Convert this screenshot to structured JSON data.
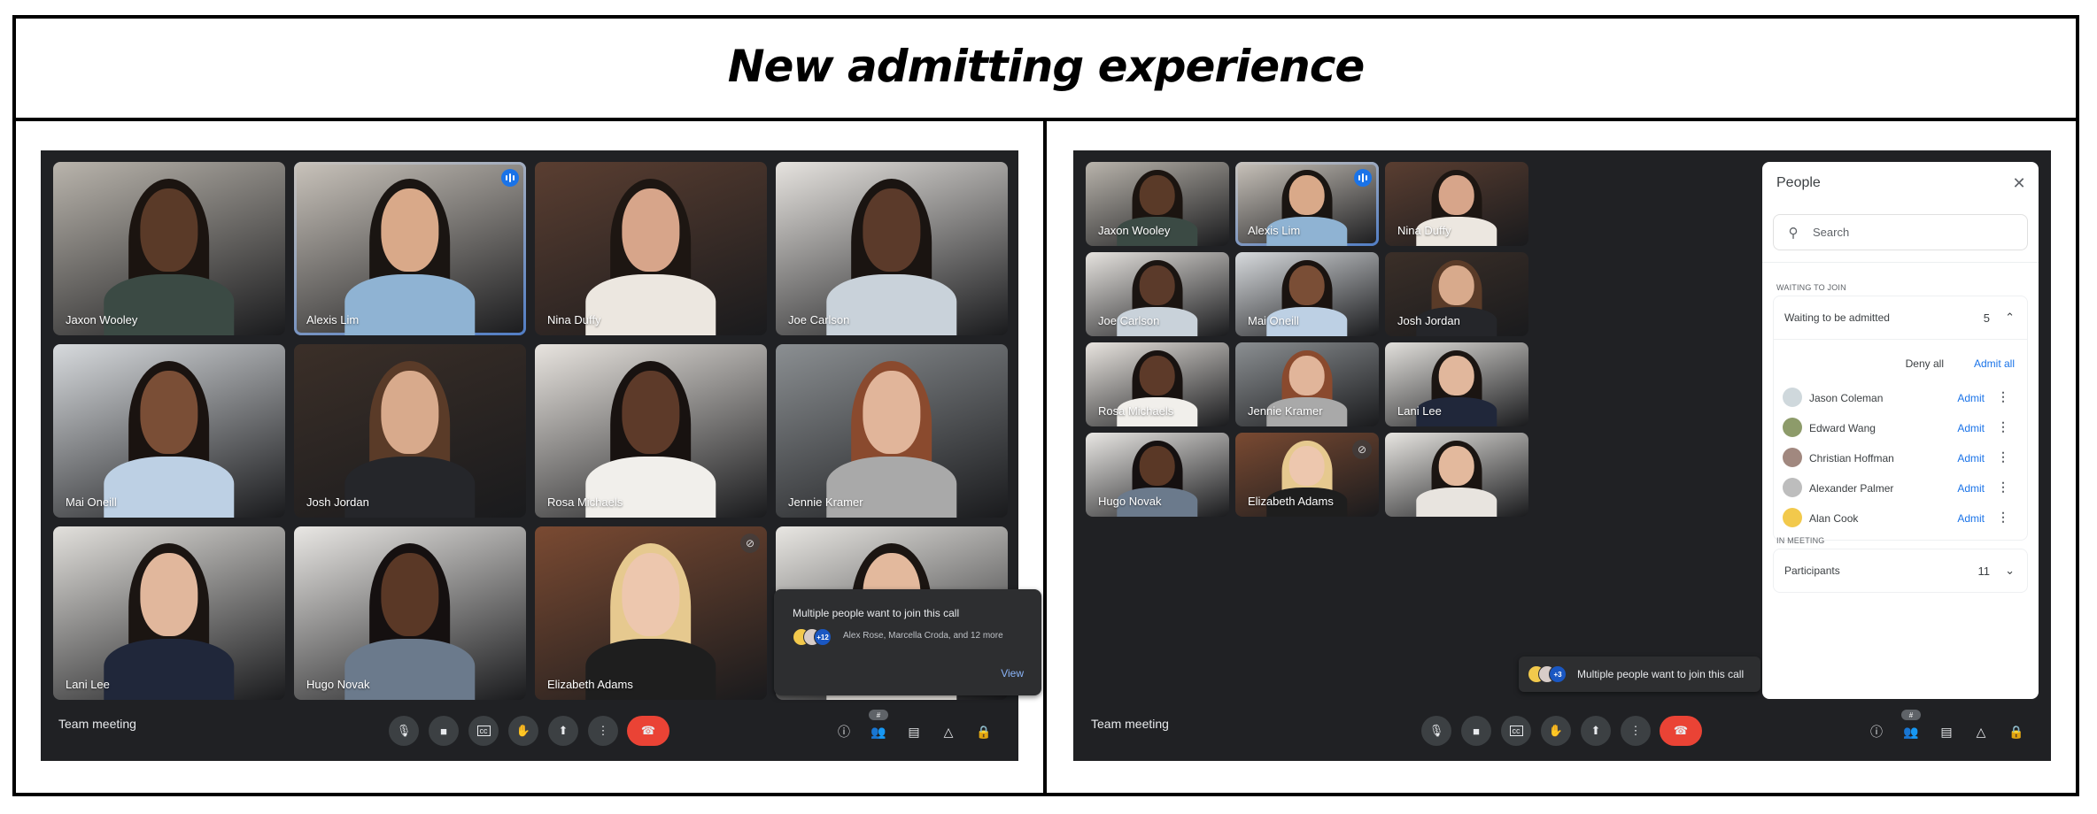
{
  "page": {
    "title": "New admitting experience"
  },
  "left": {
    "meeting_name": "Team meeting",
    "tiles": [
      {
        "name": "Jaxon Wooley",
        "state": "normal"
      },
      {
        "name": "Alexis Lim",
        "state": "speaking"
      },
      {
        "name": "Nina Duffy",
        "state": "normal"
      },
      {
        "name": "Joe Carlson",
        "state": "normal"
      },
      {
        "name": "Mai Oneill",
        "state": "normal"
      },
      {
        "name": "Josh Jordan",
        "state": "normal"
      },
      {
        "name": "Rosa Michaels",
        "state": "normal"
      },
      {
        "name": "Jennie Kramer",
        "state": "normal"
      },
      {
        "name": "Lani Lee",
        "state": "normal"
      },
      {
        "name": "Hugo Novak",
        "state": "normal"
      },
      {
        "name": "Elizabeth Adams",
        "state": "muted"
      },
      {
        "name": "",
        "state": "normal"
      }
    ],
    "notification": {
      "title": "Multiple people want to join this call",
      "names": "Alex Rose, Marcella Croda, and 12 more",
      "more_count": "+12",
      "view_label": "View"
    },
    "people_count_badge": "#"
  },
  "right": {
    "meeting_name": "Team meeting",
    "tiles": [
      {
        "name": "Jaxon Wooley",
        "state": "normal"
      },
      {
        "name": "Alexis Lim",
        "state": "speaking"
      },
      {
        "name": "Nina Duffy",
        "state": "normal"
      },
      {
        "name": "Joe Carlson",
        "state": "normal"
      },
      {
        "name": "Mai Oneill",
        "state": "normal"
      },
      {
        "name": "Josh Jordan",
        "state": "normal"
      },
      {
        "name": "Rosa Michaels",
        "state": "normal"
      },
      {
        "name": "Jennie Kramer",
        "state": "normal"
      },
      {
        "name": "Lani Lee",
        "state": "normal"
      },
      {
        "name": "Hugo Novak",
        "state": "normal"
      },
      {
        "name": "Elizabeth Adams",
        "state": "muted"
      },
      {
        "name": "",
        "state": "normal"
      }
    ],
    "chip": {
      "text": "Multiple people want to join this call",
      "more_count": "+3"
    },
    "people_count_badge": "#",
    "panel": {
      "title": "People",
      "close_icon": "close-icon",
      "search_placeholder": "Search",
      "waiting_section_label": "WAITING TO JOIN",
      "waiting_header": "Waiting to be admitted",
      "waiting_count": "5",
      "deny_all": "Deny all",
      "admit_all": "Admit all",
      "admit_label": "Admit",
      "waiting": [
        {
          "name": "Jason Coleman"
        },
        {
          "name": "Edward Wang"
        },
        {
          "name": "Christian Hoffman"
        },
        {
          "name": "Alexander Palmer"
        },
        {
          "name": "Alan Cook"
        }
      ],
      "in_meeting_label": "IN MEETING",
      "participants_label": "Participants",
      "participants_count": "11"
    }
  },
  "controls": {
    "center": [
      "mic-icon",
      "camera-icon",
      "captions-icon",
      "raise-hand-icon",
      "present-icon",
      "more-options-icon",
      "end-call-icon"
    ],
    "right": [
      "info-icon",
      "people-icon",
      "chat-icon",
      "activities-icon",
      "host-controls-icon"
    ]
  },
  "colors": {
    "meet_bg": "#202124",
    "accent_blue": "#1a73e8",
    "speaking_outline": "#669df6",
    "end_call_red": "#ea4335"
  }
}
